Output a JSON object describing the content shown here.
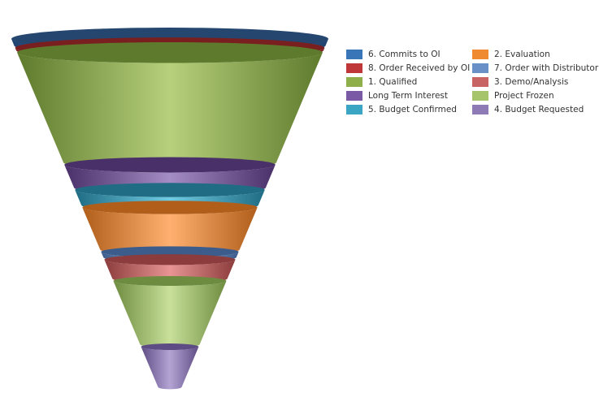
{
  "chart_data": {
    "type": "funnel",
    "title": "",
    "segments": [
      {
        "name": "6. Commits to OI",
        "share": 2.0,
        "color": "#3a75b8",
        "dark": "#1f4270",
        "light": "#7aa6d8"
      },
      {
        "name": "8. Order Received by OI",
        "share": 1.2,
        "color": "#c0373a",
        "dark": "#7a1f20",
        "light": "#e07070"
      },
      {
        "name": "1. Qualified",
        "share": 29.0,
        "color": "#8faf4a",
        "dark": "#5e7a2c",
        "light": "#b6d07c"
      },
      {
        "name": "Long Term Interest",
        "share": 6.5,
        "color": "#7a5aa4",
        "dark": "#4a3068",
        "light": "#a48cc4"
      },
      {
        "name": "5. Budget Confirmed",
        "share": 4.5,
        "color": "#3aa6c4",
        "dark": "#1f6c84",
        "light": "#70cce2"
      },
      {
        "name": "2. Evaluation",
        "share": 11.5,
        "color": "#f08a30",
        "dark": "#b05e1a",
        "light": "#ffb070"
      },
      {
        "name": "7. Order with Distributor",
        "share": 2.0,
        "color": "#6a90c8",
        "dark": "#3c5c8c",
        "light": "#9cbce8"
      },
      {
        "name": "3. Demo/Analysis",
        "share": 5.5,
        "color": "#c86464",
        "dark": "#8c3c3c",
        "light": "#e89494"
      },
      {
        "name": "Project Frozen",
        "share": 17.0,
        "color": "#a6c46c",
        "dark": "#6e8c40",
        "light": "#c8e09a"
      },
      {
        "name": "4. Budget Requested",
        "share": 11.0,
        "color": "#8e7ab4",
        "dark": "#5e4c84",
        "light": "#b4a4d4"
      }
    ],
    "legend": {
      "placement": "right",
      "columns": [
        [
          "6. Commits to OI",
          "8. Order Received by OI",
          "1. Qualified",
          "Long Term Interest",
          "5. Budget Confirmed"
        ],
        [
          "2. Evaluation",
          "7. Order with Distributor",
          "3. Demo/Analysis",
          "Project Frozen",
          "4. Budget Requested"
        ]
      ],
      "colors": {
        "6. Commits to OI": "#3a75b8",
        "8. Order Received by OI": "#c0373a",
        "1. Qualified": "#8faf4a",
        "Long Term Interest": "#7a5aa4",
        "5. Budget Confirmed": "#3aa6c4",
        "2. Evaluation": "#f08a30",
        "7. Order with Distributor": "#6a90c8",
        "3. Demo/Analysis": "#c86464",
        "Project Frozen": "#a6c46c",
        "4. Budget Requested": "#8e7ab4"
      }
    }
  }
}
